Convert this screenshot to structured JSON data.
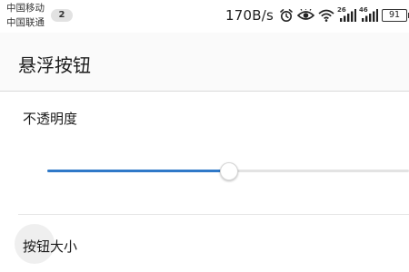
{
  "status_bar": {
    "carrier_1": "中国移动",
    "carrier_2": "中国联通",
    "notification_count": "2",
    "net_speed": "170B/s",
    "signal_1_tag": "26",
    "signal_2_tag": "46",
    "battery_level": "91",
    "icons": [
      "alarm-icon",
      "eye-icon",
      "wifi-icon",
      "signal-icon",
      "signal-icon",
      "battery-icon"
    ]
  },
  "toolbar": {
    "title": "悬浮按钮"
  },
  "settings": {
    "opacity": {
      "label": "不透明度",
      "value": 0.5
    },
    "button_size": {
      "label": "按钮大小"
    }
  },
  "colors": {
    "accent": "#2f79c8",
    "track": "#e3e3e3",
    "toolbar_bg": "#fafafa"
  }
}
